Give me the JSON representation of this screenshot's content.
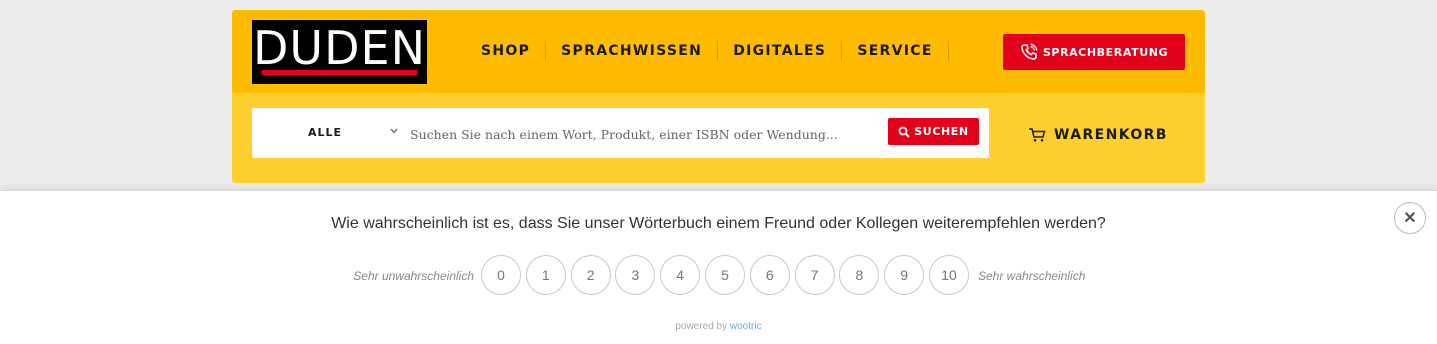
{
  "header": {
    "logo_text": "DUDEN",
    "nav": [
      "SHOP",
      "SPRACHWISSEN",
      "DIGITALES",
      "SERVICE"
    ],
    "cta_label": "SPRACHBERATUNG",
    "cta_icon": "phone-icon",
    "colors": {
      "top": "#ffbb00",
      "search_area": "#fed02f",
      "accent": "#e2001a"
    }
  },
  "search": {
    "scope": "ALLE",
    "placeholder": "Suchen Sie nach einem Wort, Produkt, einer ISBN oder Wendung...",
    "button_label": "SUCHEN",
    "button_icon": "search-icon"
  },
  "cart": {
    "label": "WARENKORB",
    "icon": "cart-icon"
  },
  "survey": {
    "question": "Wie wahrscheinlich ist es, dass Sie unser Wörterbuch einem Freund oder Kollegen weiterempfehlen werden?",
    "low_label": "Sehr unwahrscheinlich",
    "high_label": "Sehr wahrscheinlich",
    "scores": [
      "0",
      "1",
      "2",
      "3",
      "4",
      "5",
      "6",
      "7",
      "8",
      "9",
      "10"
    ],
    "close_icon": "close-icon",
    "powered_prefix": "powered by",
    "powered_brand": "wootric"
  }
}
